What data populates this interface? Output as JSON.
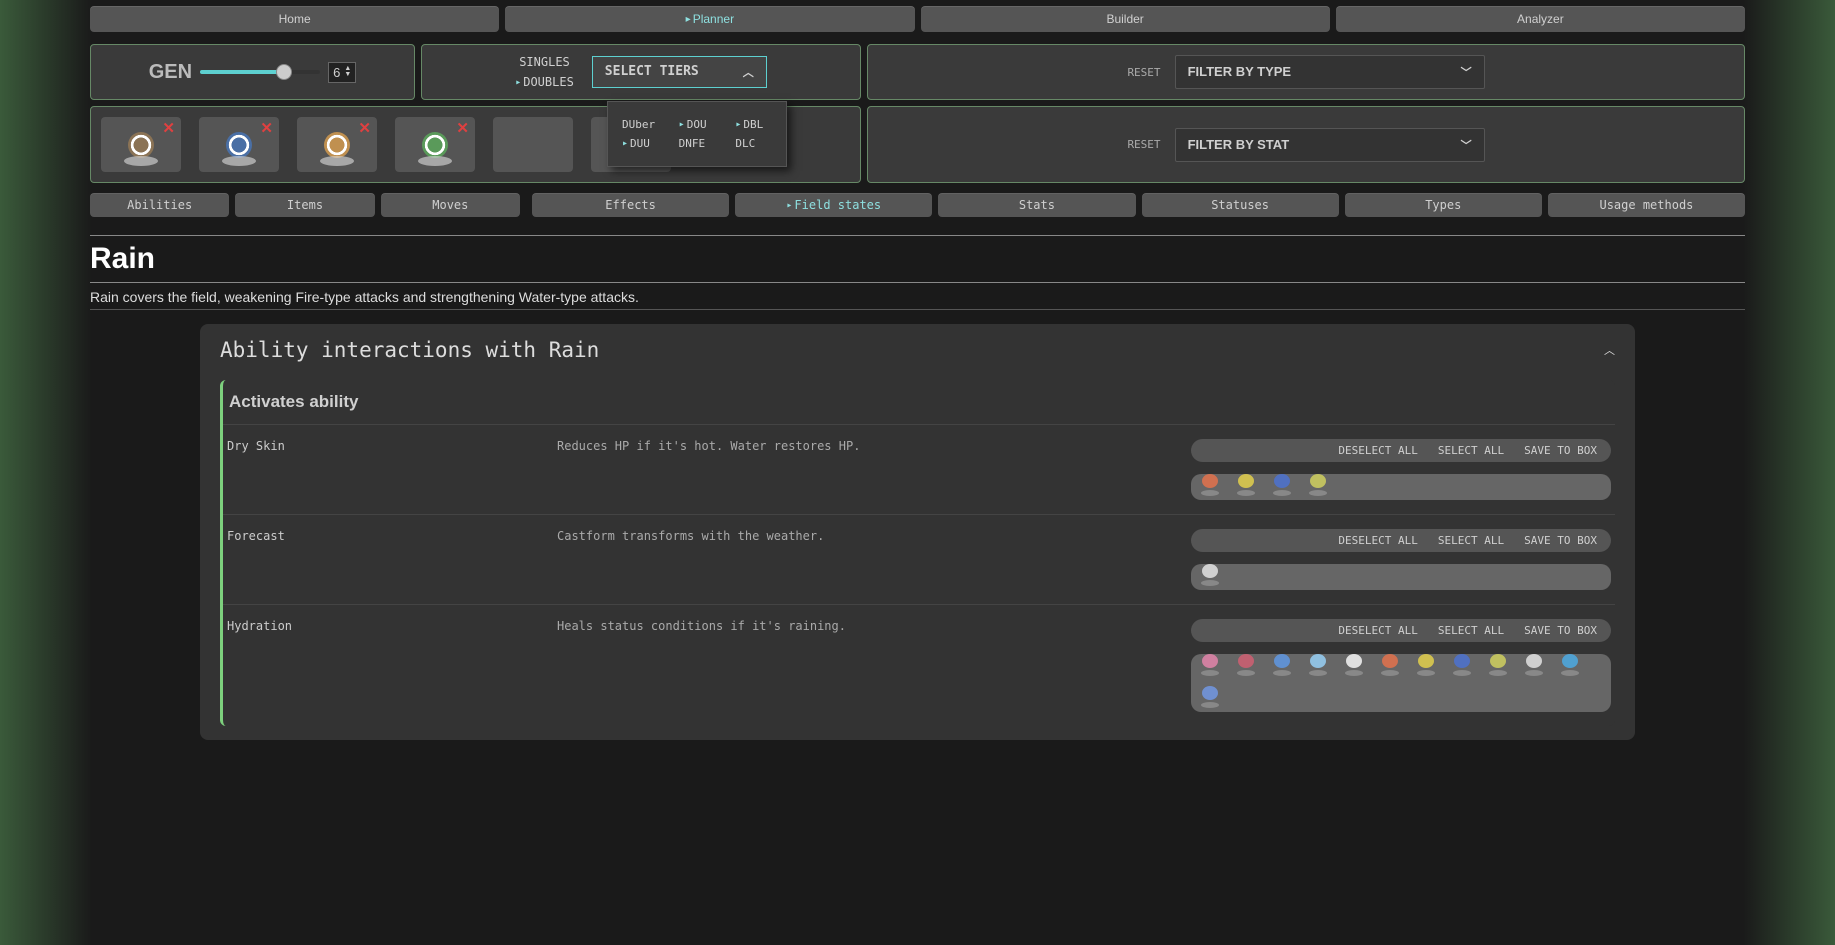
{
  "nav": {
    "home": "Home",
    "planner": "Planner",
    "builder": "Builder",
    "analyzer": "Analyzer"
  },
  "gen": {
    "label": "GEN",
    "value": "6"
  },
  "format": {
    "singles": "SINGLES",
    "doubles": "DOUBLES"
  },
  "tiers": {
    "label": "SELECT TIERS",
    "items": [
      "DUber",
      "DOU",
      "DBL",
      "DUU",
      "DNFE",
      "DLC"
    ]
  },
  "filters": {
    "reset": "RESET",
    "type": "FILTER BY TYPE",
    "stat": "FILTER BY STAT"
  },
  "subnav1": [
    "Abilities",
    "Items",
    "Moves"
  ],
  "subnav2": [
    "Effects",
    "Field states",
    "Stats",
    "Statuses",
    "Types",
    "Usage methods"
  ],
  "page": {
    "title": "Rain",
    "desc": "Rain covers the field, weakening Fire-type attacks and strengthening Water-type attacks."
  },
  "section": {
    "title": "Ability interactions with Rain",
    "subsection": "Activates ability",
    "buttons": {
      "deselect": "DESELECT ALL",
      "select": "SELECT ALL",
      "save": "SAVE TO BOX"
    },
    "abilities": [
      {
        "name": "Dry Skin",
        "desc": "Reduces HP if it's hot. Water restores HP.",
        "count": 4
      },
      {
        "name": "Forecast",
        "desc": "Castform transforms with the weather.",
        "count": 1
      },
      {
        "name": "Hydration",
        "desc": "Heals status conditions if it's raining.",
        "count": 12
      }
    ]
  }
}
